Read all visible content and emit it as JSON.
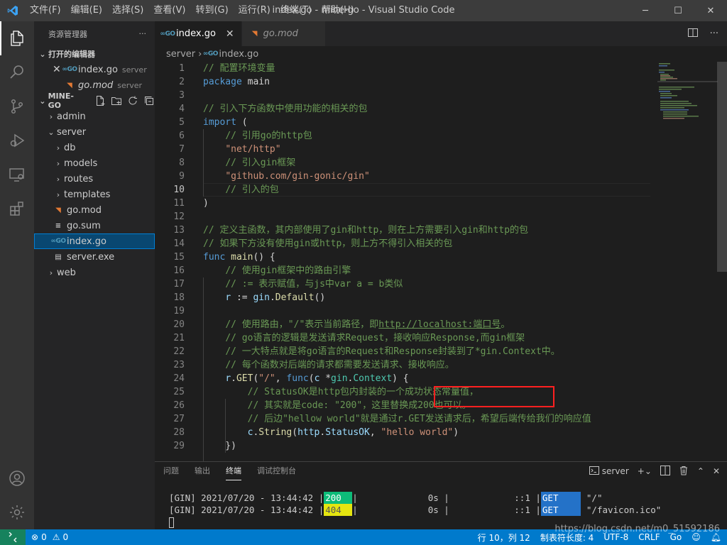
{
  "window": {
    "title": "index.go - mine-go - Visual Studio Code",
    "menu": [
      "文件(F)",
      "编辑(E)",
      "选择(S)",
      "查看(V)",
      "转到(G)",
      "运行(R)",
      "终端(T)",
      "帮助(H)"
    ]
  },
  "sidebar": {
    "header": "资源管理器",
    "open_editors_label": "打开的编辑器",
    "open_editors": [
      {
        "name": "index.go",
        "desc": "server",
        "icon": "go"
      },
      {
        "name": "go.mod",
        "desc": "server",
        "icon": "mod"
      }
    ],
    "project_label": "MINE-GO",
    "tree": [
      {
        "name": "admin",
        "type": "folder",
        "depth": 0
      },
      {
        "name": "server",
        "type": "folder-open",
        "depth": 0
      },
      {
        "name": "db",
        "type": "folder",
        "depth": 1
      },
      {
        "name": "models",
        "type": "folder",
        "depth": 1
      },
      {
        "name": "routes",
        "type": "folder",
        "depth": 1
      },
      {
        "name": "templates",
        "type": "folder",
        "depth": 1
      },
      {
        "name": "go.mod",
        "type": "mod",
        "depth": 1
      },
      {
        "name": "go.sum",
        "type": "file",
        "depth": 1
      },
      {
        "name": "index.go",
        "type": "go",
        "depth": 1,
        "selected": true
      },
      {
        "name": "server.exe",
        "type": "exe",
        "depth": 1
      },
      {
        "name": "web",
        "type": "folder",
        "depth": 0
      }
    ]
  },
  "tabs": [
    {
      "label": "index.go",
      "active": true
    },
    {
      "label": "go.mod",
      "active": false
    }
  ],
  "breadcrumb": {
    "folder": "server",
    "file": "index.go"
  },
  "code_lines": [
    [
      [
        "c-com",
        "// 配置环境变量"
      ]
    ],
    [
      [
        "c-kw",
        "package"
      ],
      [
        "c-plain",
        " main"
      ]
    ],
    [],
    [
      [
        "c-com",
        "// 引入下方函数中使用功能的相关的包"
      ]
    ],
    [
      [
        "c-kw",
        "import"
      ],
      [
        "c-plain",
        " ("
      ]
    ],
    [
      [
        "c-plain",
        "    "
      ],
      [
        "c-com",
        "// 引用go的http包"
      ]
    ],
    [
      [
        "c-plain",
        "    "
      ],
      [
        "c-str",
        "\"net/http\""
      ]
    ],
    [
      [
        "c-plain",
        "    "
      ],
      [
        "c-com",
        "// 引入gin框架"
      ]
    ],
    [
      [
        "c-plain",
        "    "
      ],
      [
        "c-str",
        "\"github.com/gin-gonic/gin\""
      ]
    ],
    [
      [
        "c-plain",
        "    "
      ],
      [
        "c-com",
        "// 引入的包"
      ]
    ],
    [
      [
        "c-plain",
        ")"
      ]
    ],
    [],
    [
      [
        "c-com",
        "// 定义主函数，其内部使用了gin和http，则在上方需要引入gin和http的包"
      ]
    ],
    [
      [
        "c-com",
        "// 如果下方没有使用gin或http，则上方不得引入相关的包"
      ]
    ],
    [
      [
        "c-kw",
        "func"
      ],
      [
        "c-plain",
        " "
      ],
      [
        "c-fn",
        "main"
      ],
      [
        "c-plain",
        "() {"
      ]
    ],
    [
      [
        "c-plain",
        "    "
      ],
      [
        "c-com",
        "// 使用gin框架中的路由引擎"
      ]
    ],
    [
      [
        "c-plain",
        "    "
      ],
      [
        "c-com",
        "// := 表示赋值，与js中var a = b类似"
      ]
    ],
    [
      [
        "c-plain",
        "    "
      ],
      [
        "c-var",
        "r"
      ],
      [
        "c-plain",
        " := "
      ],
      [
        "c-var",
        "gin"
      ],
      [
        "c-plain",
        "."
      ],
      [
        "c-fn",
        "Default"
      ],
      [
        "c-plain",
        "()"
      ]
    ],
    [],
    [
      [
        "c-plain",
        "    "
      ],
      [
        "c-com",
        "// 使用路由，\"/\"表示当前路径，即"
      ],
      [
        "c-url",
        "http://localhost:端口号"
      ],
      [
        "c-com",
        "。"
      ]
    ],
    [
      [
        "c-plain",
        "    "
      ],
      [
        "c-com",
        "// go语言的逻辑是发送请求Request，接收响应Response,而gin框架"
      ]
    ],
    [
      [
        "c-plain",
        "    "
      ],
      [
        "c-com",
        "// 一大特点就是将go语言的Request和Response封装到了*gin.Context中。"
      ]
    ],
    [
      [
        "c-plain",
        "    "
      ],
      [
        "c-com",
        "// 每个函数对后端的请求都需要发送请求、接收响应。"
      ]
    ],
    [
      [
        "c-plain",
        "    "
      ],
      [
        "c-var",
        "r"
      ],
      [
        "c-plain",
        "."
      ],
      [
        "c-fn",
        "GET"
      ],
      [
        "c-plain",
        "("
      ],
      [
        "c-str",
        "\"/\""
      ],
      [
        "c-plain",
        ", "
      ],
      [
        "c-kw",
        "func"
      ],
      [
        "c-plain",
        "("
      ],
      [
        "c-var",
        "c"
      ],
      [
        "c-plain",
        " *"
      ],
      [
        "c-type",
        "gin"
      ],
      [
        "c-plain",
        "."
      ],
      [
        "c-type",
        "Context"
      ],
      [
        "c-plain",
        ") {"
      ]
    ],
    [
      [
        "c-plain",
        "        "
      ],
      [
        "c-com",
        "// StatusOK是http包内封装的一个成功状态常量值，"
      ]
    ],
    [
      [
        "c-plain",
        "        "
      ],
      [
        "c-com",
        "// 其实就是code: \"200\"，这里替换成200也可以。"
      ]
    ],
    [
      [
        "c-plain",
        "        "
      ],
      [
        "c-com",
        "// 后边\"hellow world\"就是通过r.GET发送请求后，希望后端传给我们的响应值"
      ]
    ],
    [
      [
        "c-plain",
        "        "
      ],
      [
        "c-var",
        "c"
      ],
      [
        "c-plain",
        "."
      ],
      [
        "c-fn",
        "String"
      ],
      [
        "c-plain",
        "("
      ],
      [
        "c-var",
        "http"
      ],
      [
        "c-plain",
        "."
      ],
      [
        "c-var",
        "StatusOK"
      ],
      [
        "c-plain",
        ", "
      ],
      [
        "c-str",
        "\"hello world\""
      ],
      [
        "c-plain",
        ")"
      ]
    ],
    [
      [
        "c-plain",
        "    })"
      ]
    ]
  ],
  "current_line": 10,
  "panel": {
    "tabs": [
      "问题",
      "输出",
      "终端",
      "调试控制台"
    ],
    "active_tab": "终端",
    "terminal_name": "server",
    "lines": [
      {
        "prefix": "[GIN] 2021/07/20 - 13:44:42 |",
        "status": "200",
        "status_color": "green",
        "latency": "0s",
        "ip": "::1",
        "method": "GET",
        "path": "\"/\""
      },
      {
        "prefix": "[GIN] 2021/07/20 - 13:44:42 |",
        "status": "404",
        "status_color": "yellow",
        "latency": "0s",
        "ip": "::1",
        "method": "GET",
        "path": "\"/favicon.ico\""
      }
    ]
  },
  "statusbar": {
    "errors": "0",
    "warnings": "0",
    "position": "行 10，列 12",
    "tab_size": "制表符长度: 4",
    "encoding": "UTF-8",
    "eol": "CRLF",
    "language": "Go"
  },
  "watermark": "https://blog.csdn.net/m0_51592186"
}
